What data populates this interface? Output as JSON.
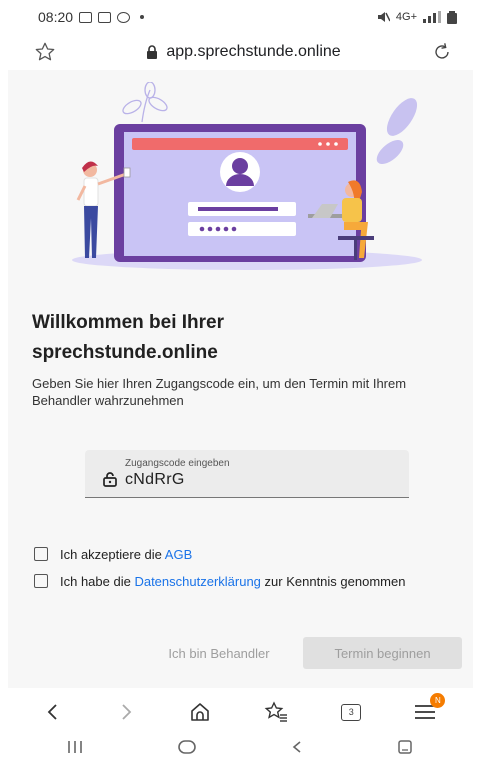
{
  "status_bar": {
    "time": "08:20",
    "network": "4G+"
  },
  "url_bar": {
    "url": "app.sprechstunde.online",
    "bookmark_icon": "star-outline-icon",
    "reload_icon": "reload-icon",
    "secure_icon": "lock-icon"
  },
  "content": {
    "title_line1": "Willkommen bei Ihrer",
    "title_line2": "sprechstunde.online",
    "description": "Geben Sie hier Ihren Zugangscode ein, um den Termin mit Ihrem Behandler wahrzunehmen",
    "code_field": {
      "label": "Zugangscode eingeben",
      "value": "cNdRrG",
      "icon": "lock-icon"
    },
    "checkbox_agb": {
      "text_before": "Ich akzeptiere die ",
      "link": "AGB",
      "checked": false
    },
    "checkbox_privacy": {
      "text_before": "Ich habe die ",
      "link": "Datenschutzerklärung",
      "text_after": " zur Kenntnis genommen",
      "checked": false
    },
    "button_behandler": "Ich bin Behandler",
    "button_begin": "Termin beginnen"
  },
  "browser_nav": {
    "tab_count": "3",
    "menu_badge": "N"
  },
  "colors": {
    "accent": "#1a73e8",
    "laptop": "#6b3fa0",
    "screen": "#c9c4f5",
    "header": "#f06b6b"
  }
}
